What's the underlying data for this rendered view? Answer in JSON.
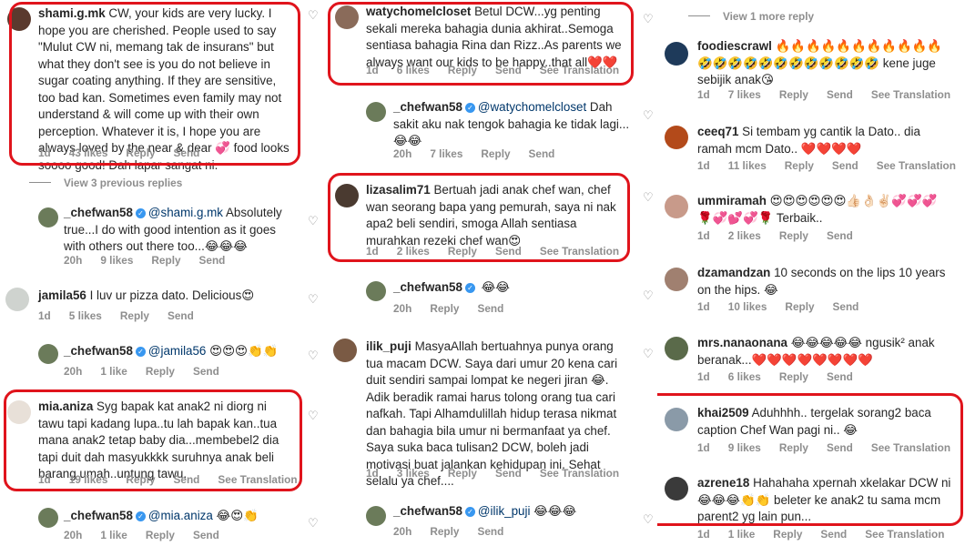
{
  "col1": {
    "c1": {
      "user": "shami.g.mk",
      "text": "CW, your kids are very lucky. I hope you are cherished. People used to say \"Mulut CW ni, memang tak de insurans\" but what they don't see is you do not believe in sugar coating anything. If they are sensitive, too bad kan. Sometimes even family may not understand & will come up with their own perception. Whatever it is, I hope you are always loved by the near & dear 💞 food looks soooo good! Dah lapar sangat ni.",
      "time": "1d",
      "likes": "43 likes",
      "reply": "Reply",
      "send": "Send"
    },
    "view_prev": "View 3 previous replies",
    "r1": {
      "user": "_chefwan58",
      "mention": "@shami.g.mk",
      "text": " Absolutely true...I do with good intention as it goes with others out there too...😂😂😂",
      "time": "20h",
      "likes": "9 likes",
      "reply": "Reply",
      "send": "Send"
    },
    "c2": {
      "user": "jamila56",
      "text": "I luv ur pizza dato. Delicious😍",
      "time": "1d",
      "likes": "5 likes",
      "reply": "Reply",
      "send": "Send"
    },
    "r2": {
      "user": "_chefwan58",
      "mention": "@jamila56",
      "text": " 😍😍😍👏👏",
      "time": "20h",
      "likes": "1 like",
      "reply": "Reply",
      "send": "Send"
    },
    "c3": {
      "user": "mia.aniza",
      "text": "Syg bapak kat anak2 ni diorg ni tawu tapi kadang lupa..tu lah bapak kan..tua mana anak2 tetap baby dia...membebel2 dia tapi duit dah masyukkkk suruhnya anak beli barang umah..untung tawu.",
      "time": "1d",
      "likes": "19 likes",
      "reply": "Reply",
      "send": "Send",
      "translate": "See Translation"
    },
    "r3": {
      "user": "_chefwan58",
      "mention": "@mia.aniza",
      "text": " 😂😍👏",
      "time": "20h",
      "likes": "1 like",
      "reply": "Reply",
      "send": "Send"
    }
  },
  "col2": {
    "c1": {
      "user": "watychomelcloset",
      "text": "Betul DCW...yg penting sekali mereka bahagia dunia akhirat..Semoga sentiasa bahagia Rina dan Rizz..As parents we always want our kids to be happy..that all❤️❤️",
      "time": "1d",
      "likes": "6 likes",
      "reply": "Reply",
      "send": "Send",
      "translate": "See Translation"
    },
    "r1": {
      "user": "_chefwan58",
      "mention": "@watychomelcloset",
      "text": " Dah sakit aku nak tengok bahagia ke tidak lagi...😂😂",
      "time": "20h",
      "likes": "7 likes",
      "reply": "Reply",
      "send": "Send"
    },
    "c2": {
      "user": "lizasalim71",
      "text": "Bertuah jadi anak chef wan, chef wan seorang bapa yang pemurah, saya ni nak apa2 beli sendiri, smoga Allah sentiasa murahkan rezeki chef wan😍",
      "time": "1d",
      "likes": "2 likes",
      "reply": "Reply",
      "send": "Send",
      "translate": "See Translation"
    },
    "r2": {
      "user": "_chefwan58",
      "text": " 😂😂",
      "time": "20h",
      "reply": "Reply",
      "send": "Send"
    },
    "c3": {
      "user": "ilik_puji",
      "text": "MasyaAllah bertuahnya punya orang tua macam DCW. Saya dari umur 20  kena cari duit sendiri sampai lompat ke negeri jiran 😂. Adik beradik ramai harus tolong orang tua cari nafkah. Tapi Alhamdulillah hidup terasa nikmat dan bahagia bila umur ni bermanfaat ya chef. Saya suka baca tulisan2 DCW, boleh  jadi motivasi buat jalankan kehidupan ini. Sehat selalu ya chef....",
      "time": "1d",
      "likes": "3 likes",
      "reply": "Reply",
      "send": "Send",
      "translate": "See Translation"
    },
    "r3": {
      "user": "_chefwan58",
      "mention": "@ilik_puji",
      "text": " 😂😂😂",
      "time": "20h",
      "reply": "Reply",
      "send": "Send"
    }
  },
  "col3": {
    "view_more": "View 1 more reply",
    "c1": {
      "user": "foodiescrawl",
      "text": "🔥🔥🔥🔥🔥🔥🔥🔥🔥🔥🔥 🤣🤣🤣🤣🤣🤣🤣🤣🤣🤣🤣🤣 kene juge sebijik anak😘",
      "time": "1d",
      "likes": "7 likes",
      "reply": "Reply",
      "send": "Send",
      "translate": "See Translation"
    },
    "c2": {
      "user": "ceeq71",
      "text": "Si tembam yg cantik la Dato.. dia ramah mcm Dato.. ❤️❤️❤️❤️",
      "time": "1d",
      "likes": "11 likes",
      "reply": "Reply",
      "send": "Send",
      "translate": "See Translation"
    },
    "c3": {
      "user": "ummiramah",
      "text": "😍😍😍😍😍😍👍🏻👌🏻✌🏻💞💞💞 🌹💞💕💞🌹 Terbaik..",
      "time": "1d",
      "likes": "2 likes",
      "reply": "Reply",
      "send": "Send"
    },
    "c4": {
      "user": "dzamandzan",
      "text": "10 seconds on the lips 10 years on the hips. 😂",
      "time": "1d",
      "likes": "10 likes",
      "reply": "Reply",
      "send": "Send"
    },
    "c5": {
      "user": "mrs.nanaonana",
      "text": "😂😂😂😂😂 ngusik² anak beranak...❤️❤️❤️❤️❤️❤️❤️❤️",
      "time": "1d",
      "likes": "6 likes",
      "reply": "Reply",
      "send": "Send"
    },
    "c6": {
      "user": "khai2509",
      "text": "Aduhhhh.. tergelak sorang2 baca caption Chef Wan pagi ni.. 😂",
      "time": "1d",
      "likes": "9 likes",
      "reply": "Reply",
      "send": "Send",
      "translate": "See Translation"
    },
    "c7": {
      "user": "azrene18",
      "text": "Hahahaha xpernah xkelakar DCW ni 😂😂😂👏👏 beleter ke anak2 tu sama mcm parent2 yg lain pun...",
      "time": "1d",
      "likes": "1 like",
      "reply": "Reply",
      "send": "Send",
      "translate": "See Translation"
    }
  },
  "colors": {
    "highlight": "#e0141c",
    "meta": "#8e8e8e",
    "mention": "#00376b",
    "verified": "#3897f0"
  }
}
